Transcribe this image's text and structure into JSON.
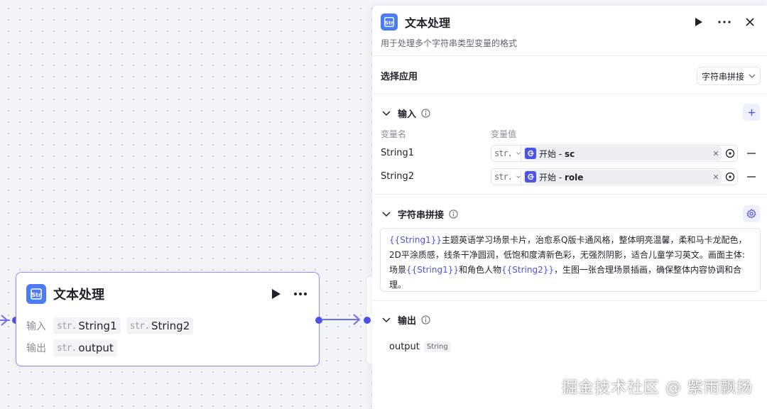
{
  "node": {
    "title": "文本处理",
    "input_label": "输入",
    "output_label": "输出",
    "inputs": [
      {
        "type": "str.",
        "name": "String1"
      },
      {
        "type": "str.",
        "name": "String2"
      }
    ],
    "outputs": [
      {
        "type": "str.",
        "name": "output"
      }
    ]
  },
  "panel": {
    "title": "文本处理",
    "description": "用于处理多个字符串类型变量的格式",
    "select_app": {
      "label": "选择应用",
      "value": "字符串拼接"
    },
    "input_section": {
      "title": "输入",
      "col_name": "变量名",
      "col_value": "变量值",
      "rows": [
        {
          "name": "String1",
          "type": "str.",
          "ref_prefix": "开始 - ",
          "ref_var": "sc"
        },
        {
          "name": "String2",
          "type": "str.",
          "ref_prefix": "开始 - ",
          "ref_var": "role"
        }
      ]
    },
    "concat_section": {
      "title": "字符串拼接",
      "parts": [
        {
          "t": "{{String1}}",
          "v": true
        },
        {
          "t": "主题英语学习场景卡片，治愈系Q版卡通风格，整体明亮温馨，柔和马卡龙配色，2D平涂质感，线条干净圆润，低饱和度清新色彩，无强烈阴影，适合儿童学习英文。画面主体: 场景",
          "v": false
        },
        {
          "t": "{{String1}}",
          "v": true
        },
        {
          "t": "和角色人物",
          "v": false
        },
        {
          "t": "{{String2}}",
          "v": true
        },
        {
          "t": "，生图一张合理场景插画，确保整体内容协调和合理。",
          "v": false
        }
      ]
    },
    "output_section": {
      "title": "输出",
      "name": "output",
      "type": "String"
    }
  },
  "watermark": "掘金技术社区 @ 紫雨飘扬",
  "colors": {
    "accent": "#4d53e8",
    "node_icon": "#4b7bf5",
    "node_border": "#8b8ff0"
  },
  "icons": [
    "str-icon",
    "play-icon",
    "more-icon",
    "close-icon",
    "chevron-down-icon",
    "info-icon",
    "plus-icon",
    "gear-icon",
    "start-ref-icon",
    "target-icon",
    "minus-icon"
  ]
}
